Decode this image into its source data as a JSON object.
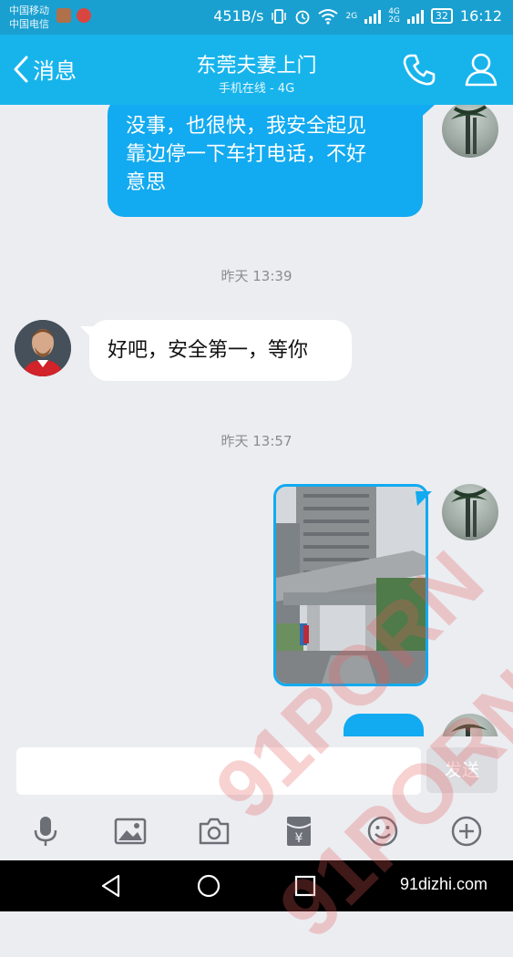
{
  "status_bar": {
    "carrier_1": "中国移动",
    "carrier_2": "中国电信",
    "speed": "451B/s",
    "network_1": "2G",
    "network_2": "4G",
    "network_3": "2G",
    "battery": "32",
    "time": "16:12"
  },
  "header": {
    "back_label": "消息",
    "title": "东莞夫妻上门",
    "subtitle": "手机在线 - 4G",
    "accent": "#17b4ec"
  },
  "messages": [
    {
      "kind": "outgoing-text",
      "lines": [
        "没事，也很快，我安全起见",
        "靠边停一下车打电话，不好",
        "意思"
      ]
    },
    {
      "kind": "timestamp",
      "text": "昨天 13:39"
    },
    {
      "kind": "incoming-text",
      "text": "好吧，安全第一，等你"
    },
    {
      "kind": "timestamp",
      "text": "昨天 13:57"
    },
    {
      "kind": "outgoing-image",
      "image": "photo of residential tower entrance gate"
    },
    {
      "kind": "outgoing-partial"
    }
  ],
  "input": {
    "placeholder": "",
    "send_label": "发送"
  },
  "toolbar": [
    "mic-icon",
    "image-icon",
    "camera-icon",
    "red-packet-icon",
    "emoji-icon",
    "plus-icon"
  ],
  "watermark": {
    "text": "91PORN"
  },
  "footer": {
    "site": "91dizhi.com"
  }
}
